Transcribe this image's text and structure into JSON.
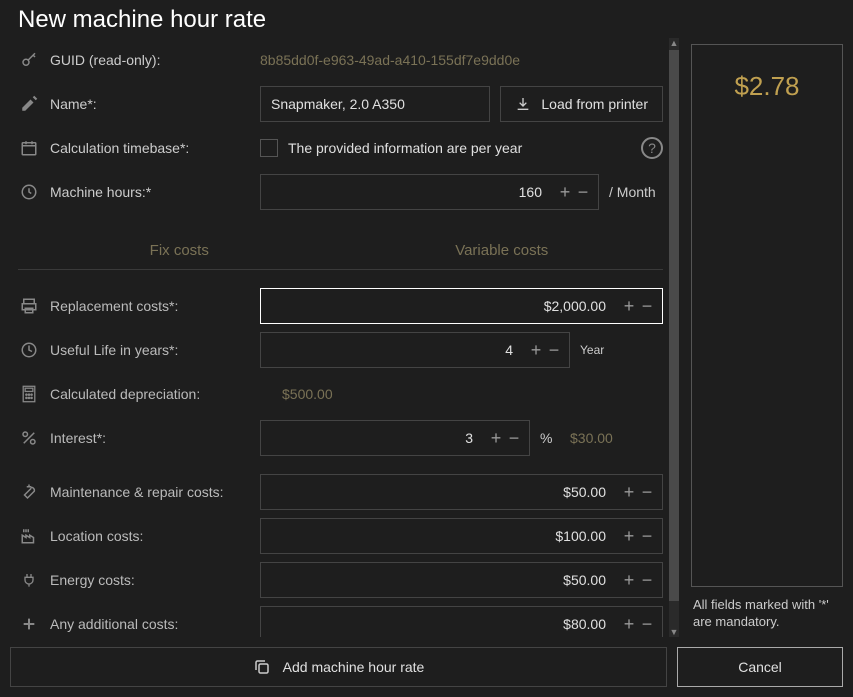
{
  "title": "New machine hour rate",
  "guid": {
    "label": "GUID (read-only):",
    "value": "8b85dd0f-e963-49ad-a410-155df7e9dd0e"
  },
  "name": {
    "label": "Name*:",
    "value": "Snapmaker, 2.0 A350"
  },
  "loadFromPrinter": "Load from printer",
  "timebase": {
    "label": "Calculation timebase*:",
    "checkbox_label": "The provided information are per year"
  },
  "machineHours": {
    "label": "Machine hours:*",
    "value": "160",
    "unit": "/ Month"
  },
  "tabs": {
    "fix": "Fix costs",
    "variable": "Variable costs"
  },
  "replacement": {
    "label": "Replacement costs*:",
    "value": "$2,000.00"
  },
  "usefulLife": {
    "label": "Useful Life in years*:",
    "value": "4",
    "unit": "Year"
  },
  "depreciation": {
    "label": "Calculated depreciation:",
    "value": "$500.00"
  },
  "interest": {
    "label": "Interest*:",
    "value": "3",
    "pct": "%",
    "amount": "$30.00"
  },
  "maintenance": {
    "label": "Maintenance & repair costs:",
    "value": "$50.00"
  },
  "location": {
    "label": "Location costs:",
    "value": "$100.00"
  },
  "energy": {
    "label": "Energy costs:",
    "value": "$50.00"
  },
  "additional": {
    "label": "Any additional costs:",
    "value": "$80.00"
  },
  "rate": "$2.78",
  "mandatory": "All fields marked with '*' are mandatory.",
  "addBtn": "Add machine hour rate",
  "cancelBtn": "Cancel"
}
